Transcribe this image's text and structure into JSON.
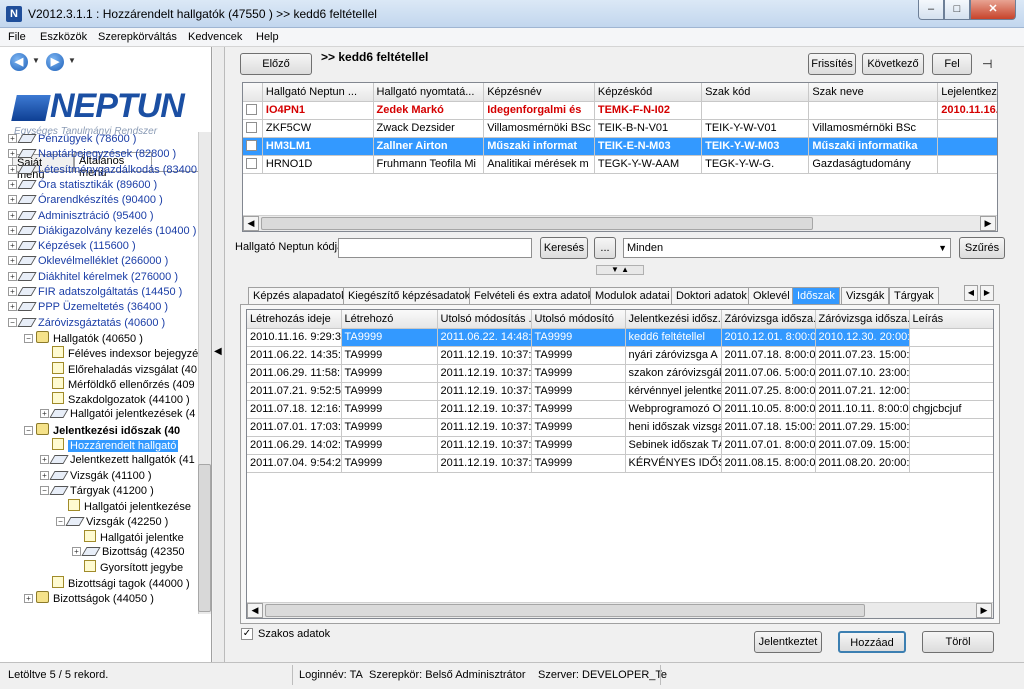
{
  "window": {
    "app_icon": "N",
    "title": "V2012.3.1.1 : Hozzárendelt hallgatók (47550  )  >> kedd6 feltétellel",
    "min": "–",
    "max": "□",
    "close": "✕"
  },
  "menu": [
    "File",
    "Eszközök",
    "Szerepkörváltás",
    "Kedvencek",
    "Help"
  ],
  "left": {
    "back_icon": "left-arrow-icon",
    "forward_icon": "right-arrow-icon",
    "logo_text": "NEPTUN",
    "logo_subtitle": "Egységes Tanulmányi Rendszer",
    "tabs": [
      "Saját menü",
      "Általános menü"
    ],
    "tree": [
      {
        "label": "Pénzügyek (78600  )",
        "level": 0,
        "exp": "+"
      },
      {
        "label": "Naptárbejegyzések (82800  )",
        "level": 0,
        "exp": "+"
      },
      {
        "label": "Létesítménygazdálkodás (83400",
        "level": 0,
        "exp": "+"
      },
      {
        "label": "Óra statisztikák (89600  )",
        "level": 0,
        "exp": "+"
      },
      {
        "label": "Órarendkészítés (90400  )",
        "level": 0,
        "exp": "+"
      },
      {
        "label": "Adminisztráció (95400  )",
        "level": 0,
        "exp": "+"
      },
      {
        "label": "Diákigazolvány kezelés (10400  )",
        "level": 0,
        "exp": "+"
      },
      {
        "label": "Képzések (115600  )",
        "level": 0,
        "exp": "+"
      },
      {
        "label": "Oklevélmelléklet (266000  )",
        "level": 0,
        "exp": "+"
      },
      {
        "label": "Diákhitel kérelmek (276000  )",
        "level": 0,
        "exp": "+"
      },
      {
        "label": "FIR adatszolgáltatás (14450  )",
        "level": 0,
        "exp": "+"
      },
      {
        "label": "PPP Üzemeltetés (36400  )",
        "level": 0,
        "exp": "+"
      },
      {
        "label": "Záróvizsgáztatás (40600  )",
        "level": 0,
        "exp": "−"
      },
      {
        "label": "Hallgatók (40650  )",
        "level": 1,
        "exp": "−"
      },
      {
        "label": "Féléves indexsor bejegyzé",
        "level": 2,
        "exp": ""
      },
      {
        "label": "Előrehaladás vizsgálat (40",
        "level": 2,
        "exp": ""
      },
      {
        "label": "Mérföldkő ellenőrzés (409",
        "level": 2,
        "exp": ""
      },
      {
        "label": "Szakdolgozatok (44100  )",
        "level": 2,
        "exp": ""
      },
      {
        "label": "Hallgatói jelentkezések (4",
        "level": 2,
        "exp": "+"
      },
      {
        "label": "Jelentkezési időszak (40",
        "level": 1,
        "exp": "−",
        "bold": true
      },
      {
        "label": "Hozzárendelt hallgató",
        "level": 2,
        "exp": "",
        "selected": true
      },
      {
        "label": "Jelentkezett hallgatók (41",
        "level": 2,
        "exp": "+"
      },
      {
        "label": "Vizsgák (41100  )",
        "level": 2,
        "exp": "+"
      },
      {
        "label": "Tárgyak (41200  )",
        "level": 2,
        "exp": "−"
      },
      {
        "label": "Hallgatói jelentkezése",
        "level": 3,
        "exp": ""
      },
      {
        "label": "Vizsgák (42250  )",
        "level": 3,
        "exp": "−"
      },
      {
        "label": "Hallgatói jelentke",
        "level": 4,
        "exp": ""
      },
      {
        "label": "Bizottság (42350",
        "level": 4,
        "exp": "+"
      },
      {
        "label": "Gyorsított jegybe",
        "level": 4,
        "exp": ""
      },
      {
        "label": "Bizottsági tagok (44000  )",
        "level": 2,
        "exp": ""
      },
      {
        "label": "Bizottságok (44050  )",
        "level": 1,
        "exp": "+"
      }
    ]
  },
  "toolbar": {
    "prev": "Előző",
    "filter_title": ">> kedd6 feltétellel",
    "refresh": "Frissítés",
    "next": "Következő",
    "up": "Fel",
    "pin_icon": "pin-icon"
  },
  "top_grid": {
    "headers": [
      "",
      "Hallgató Neptun ...",
      "Hallgató nyomtatá...",
      "Képzésnév",
      "Képzéskód",
      "Szak kód",
      "Szak neve",
      "Lejelentkezés dát...",
      "Jelentkezé"
    ],
    "rows": [
      {
        "cells": [
          "",
          "IO4PN1",
          "Zedek Markó",
          "Idegenforgalmi és",
          "TEMK-F-N-I02",
          "",
          "",
          "2010.11.16.",
          "2010.11."
        ],
        "style": "red"
      },
      {
        "cells": [
          "",
          "ZKF5CW",
          "Zwack Dezsider",
          "Villamosmérnöki BSc",
          "TEIK-B-N-V01",
          "TEIK-Y-W-V01",
          "Villamosmérnöki BSc",
          "",
          ""
        ],
        "style": ""
      },
      {
        "cells": [
          "",
          "HM3LM1",
          "Zallner Airton",
          "Műszaki informat",
          "TEIK-E-N-M03",
          "TEIK-Y-W-M03",
          "Műszaki informatika",
          "",
          ""
        ],
        "style": "sel"
      },
      {
        "cells": [
          "",
          "HRNO1D",
          "Fruhmann Teofila Mi",
          "Analitikai mérések m",
          "TEGK-Y-W-AAM",
          "TEGK-Y-W-G.",
          "Gazdaságtudomány",
          "",
          ""
        ],
        "style": ""
      }
    ]
  },
  "search": {
    "label": "Hallgató Neptun kódja",
    "value": "",
    "search_button": "Keresés",
    "ellipsis_button": "...",
    "filter_value": "Minden",
    "filter_button": "Szűrés"
  },
  "tabs": [
    "Képzés alapadatok",
    "Kiegészítő képzésadatok",
    "Felvételi és extra adatok",
    "Modulok adatai",
    "Doktori adatok",
    "Oklevél",
    "Időszak",
    "Vizsgák",
    "Tárgyak"
  ],
  "bottom_grid": {
    "headers": [
      "Létrehozás ideje",
      "Létrehozó",
      "Utolsó módosítás ...",
      "Utolsó módosító",
      "Jelentkezési idősz...",
      "Záróvizsga idősza...",
      "Záróvizsga idősza...",
      "Leírás"
    ],
    "rows": [
      [
        "2010.11.16. 9:29:32",
        "TA9999",
        "2011.06.22. 14:48:1",
        "TA9999",
        "kedd6 feltétellel",
        "2010.12.01. 8:00:00",
        "2010.12.30. 20:00:0",
        ""
      ],
      [
        "2011.06.22. 14:35:1",
        "TA9999",
        "2011.12.19. 10:37:3",
        "TA9999",
        "nyári záróvizsga A ID",
        "2011.07.18. 8:00:00",
        "2011.07.23. 15:00:0",
        ""
      ],
      [
        "2011.06.29. 11:58:1",
        "TA9999",
        "2011.12.19. 10:37:3",
        "TA9999",
        "szakon záróvizsgák",
        "2011.07.06. 5:00:00",
        "2011.07.10. 23:00:0",
        ""
      ],
      [
        "2011.07.21. 9:52:57",
        "TA9999",
        "2011.12.19. 10:37:3",
        "TA9999",
        "kérvénnyel jelentkez",
        "2011.07.25. 8:00:00",
        "2011.07.21. 12:00:0",
        ""
      ],
      [
        "2011.07.18. 12:16:0",
        "TA9999",
        "2011.12.19. 10:37:3",
        "TA9999",
        "Webprogramozó OK",
        "2011.10.05. 8:00:00",
        "2011.10.11. 8:00:00",
        "chgjcbcjuf"
      ],
      [
        "2011.07.01. 17:03:5",
        "TA9999",
        "2011.12.19. 10:37:3",
        "TA9999",
        "heni időszak vizsga",
        "2011.07.18. 15:00:0",
        "2011.07.29. 15:00:0",
        ""
      ],
      [
        "2011.06.29. 14:02:1",
        "TA9999",
        "2011.12.19. 10:37:3",
        "TA9999",
        "Sebinek időszak TÁ",
        "2011.07.01. 8:00:00",
        "2011.07.09. 15:00:0",
        ""
      ],
      [
        "2011.07.04. 9:54:29",
        "TA9999",
        "2011.12.19. 10:37:3",
        "TA9999",
        "KÉRVÉNYES IDŐS.",
        "2011.08.15. 8:00:00",
        "2011.08.20. 20:00:0",
        ""
      ]
    ]
  },
  "bottom": {
    "checkbox_label": "Szakos adatok",
    "checkbox_checked": "✓",
    "apply_button": "Jelentkeztet",
    "add_button": "Hozzáad",
    "delete_button": "Töröl"
  },
  "status": {
    "loaded": "Letöltve 5 / 5 rekord.",
    "login": "Loginnév: TA",
    "role": "Szerepkör: Belső Adminisztrátor",
    "server": "Szerver: DEVELOPER_Te"
  }
}
